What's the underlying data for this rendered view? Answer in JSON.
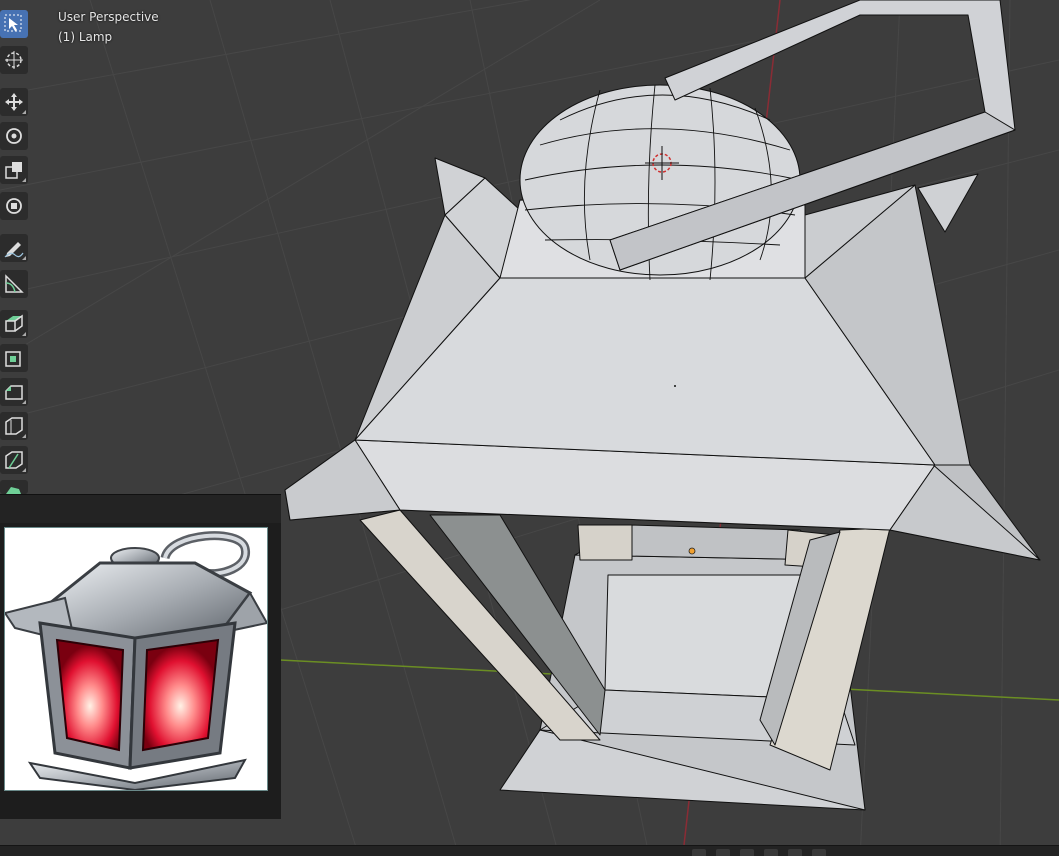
{
  "viewport": {
    "view_mode": "User Perspective",
    "object_label": "(1) Lamp"
  },
  "toolbar": {
    "tools": [
      {
        "name": "select-box-tool",
        "icon": "cursor-select-icon",
        "active": true
      },
      {
        "name": "cursor-tool",
        "icon": "3d-cursor-icon"
      },
      {
        "name": "move-tool",
        "icon": "move-arrows-icon"
      },
      {
        "name": "rotate-tool",
        "icon": "rotate-icon"
      },
      {
        "name": "scale-tool",
        "icon": "scale-icon"
      },
      {
        "name": "transform-tool",
        "icon": "transform-icon"
      },
      {
        "name": "annotate-tool",
        "icon": "pencil-icon"
      },
      {
        "name": "measure-tool",
        "icon": "ruler-icon"
      },
      {
        "name": "extrude-tool",
        "icon": "extrude-icon"
      },
      {
        "name": "inset-tool",
        "icon": "inset-icon"
      },
      {
        "name": "bevel-tool",
        "icon": "bevel-icon"
      },
      {
        "name": "loop-cut-tool",
        "icon": "loop-cut-icon"
      },
      {
        "name": "knife-tool",
        "icon": "knife-icon"
      },
      {
        "name": "poly-build-tool",
        "icon": "poly-build-icon"
      }
    ]
  },
  "reference_image": {
    "subject": "lantern-illustration-icon"
  },
  "colors": {
    "viewport_bg": "#3d3d3d",
    "grid": "#474747",
    "x_axis": "#8a2c35",
    "y_axis": "#6b8e23",
    "mesh_face": "#d5d7da",
    "mesh_edge": "#111111",
    "active_tool": "#4772b3"
  }
}
